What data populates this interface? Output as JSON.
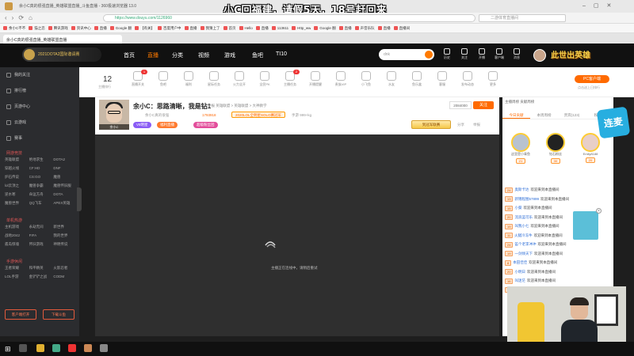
{
  "window": {
    "title": "余小C真的很强直播_英雄联盟直播_斗鱼直播 - 360极速浏览器 13.0"
  },
  "overlay_caption": "小C回福建，请假5天，18号赶回来",
  "address": {
    "url": "https://www.douyu.com/1126960",
    "search_placeholder": "二游体育直播间"
  },
  "bookmarks": [
    "余小C不不",
    "猫之恋",
    "腾讯游戏",
    "资讯中心",
    "直播",
    "Google 翻",
    "【有关】",
    "百度用户中",
    "直播",
    "我猜上了",
    "首页",
    "Hello",
    "直播",
    "113611",
    "Http_ww",
    "Google 翻",
    "直播",
    "声音乐队",
    "直播",
    "直播间"
  ],
  "tab": {
    "label": "余小C真的很强直播_英雄联盟直播"
  },
  "header": {
    "logo_text": "2021DOTA2国际邀请赛",
    "nav": [
      "首页",
      "直播",
      "分类",
      "视频",
      "游戏",
      "鱼吧",
      "TI10"
    ],
    "search_placeholder": "dnk",
    "icons": [
      "历史",
      "关注",
      "开播",
      "客户端",
      "消息",
      "任务中心"
    ],
    "banner": "此世出英雄"
  },
  "sidebar": {
    "items": [
      "我的关注",
      "排行榜",
      "页游中心",
      "云游戏",
      "赛事"
    ],
    "sections": [
      {
        "title": "网游竞技",
        "games": [
          "英雄联盟",
          "绝地求生",
          "DOTA2",
          "穿越火线",
          "CF:HD",
          "DNF",
          "炉石传说",
          "CS:GO",
          "魔兽",
          "lol云顶之",
          "魔兽争霸",
          "魔兽怀旧服",
          "逆水寒",
          "命运方舟",
          "DOTA",
          "魔兽世界",
          "QQ飞车",
          "APEX英雄"
        ]
      },
      {
        "title": "单机热游",
        "games": [
          "主机游戏",
          "永劫无间",
          "新世界",
          "战地2042",
          "FIFA",
          "我的世界",
          "孤岛惊魂",
          "怀旧游戏",
          "神明传说"
        ]
      },
      {
        "title": "手游休闲",
        "games": [
          "王者荣耀",
          "和平精英",
          "火影忍者",
          "LOL手游",
          "金铲铲之战",
          "CODM"
        ]
      }
    ],
    "btn_client": "客户端打开",
    "btn_download": "下载斗鱼"
  },
  "categories": {
    "rank_num": "12",
    "rank_label": "主播排行",
    "items": [
      {
        "label": "直播开关",
        "badge": "1"
      },
      {
        "label": "鱼吧"
      },
      {
        "label": "福利"
      },
      {
        "label": "星际任务"
      },
      {
        "label": "火力全开"
      },
      {
        "label": "全民PK"
      },
      {
        "label": "主播任务",
        "badge": "2"
      },
      {
        "label": "开播提醒"
      },
      {
        "label": "贵族VIP"
      },
      {
        "label": "小飞鱼"
      },
      {
        "label": "水友"
      },
      {
        "label": "鱼乐盒"
      },
      {
        "label": "客服"
      },
      {
        "label": "发布动态"
      },
      {
        "label": "更多"
      }
    ],
    "pc_btn": "PC客户端",
    "pc_sub": "点击送上日排行"
  },
  "room": {
    "title": "余小C：思路清晰，我是钻1",
    "anchor_tag": "余小C",
    "meta1": "举报  英雄联盟 > 英雄联盟 > 大神教学",
    "meta2_name": "余小C真的很强",
    "meta2_num": "1793918",
    "hot_tag": "2020LOL全明星SOLO赛冠军",
    "meta2_extra": "手游  999+kg",
    "tags": [
      "V8明星",
      "福利直播",
      "超级粉丝团"
    ],
    "tag_colors": [
      "#8a5cf5",
      "#ff7a2e",
      "#e34d9b"
    ],
    "follow_count": "2084000",
    "follow": "关注",
    "share": "分享",
    "report": "举报",
    "to_chess": "到冠军联赛"
  },
  "video": {
    "loading_text": "主播正在连线中，请稍后重试"
  },
  "right_panel": {
    "top": "主播周榜  贡献周榜",
    "tabs": [
      "今日贡献",
      "本周周榜",
      "贵宾(123)",
      "粉丝团"
    ],
    "ranks": [
      {
        "name": "这里是小青鱼",
        "level": "21"
      },
      {
        "name": "钻石粉丝",
        "level": "30"
      },
      {
        "name": "Emily8188",
        "level": "20"
      }
    ],
    "chat": [
      {
        "lv": "24",
        "user": "奥斯卡达",
        "msg": "欢迎来到本直播间"
      },
      {
        "lv": "13",
        "user": "新锦程图57899",
        "msg": "欢迎来到本直播间"
      },
      {
        "lv": "15",
        "user": "小葵",
        "msg": "欢迎来到本直播间"
      },
      {
        "lv": "20",
        "user": "流浪蓝可乐",
        "msg": "欢迎来到本直播间"
      },
      {
        "lv": "19",
        "user": "叫我小七",
        "msg": "欢迎来到本直播间"
      },
      {
        "lv": "11",
        "user": "火腿冷冻牛",
        "msg": "欢迎来到本直播间"
      },
      {
        "lv": "24",
        "user": "笛个老李冲冲",
        "msg": "欢迎来到本直播间"
      },
      {
        "lv": "19",
        "user": "一剑倾天下",
        "msg": "欢迎来到本直播间"
      },
      {
        "lv": "8",
        "user": "本田佳佳",
        "msg": "欢迎来到本直播间"
      },
      {
        "lv": "20",
        "user": "小明日",
        "msg": "欢迎来到本直播间"
      },
      {
        "lv": "16",
        "user": "叫迷茫",
        "msg": "欢迎来到本直播间"
      },
      {
        "lv": "13",
        "user": "风流潇洒欧阳",
        "msg": "欢迎来到本直播间"
      }
    ]
  },
  "float_logo": "连麦"
}
